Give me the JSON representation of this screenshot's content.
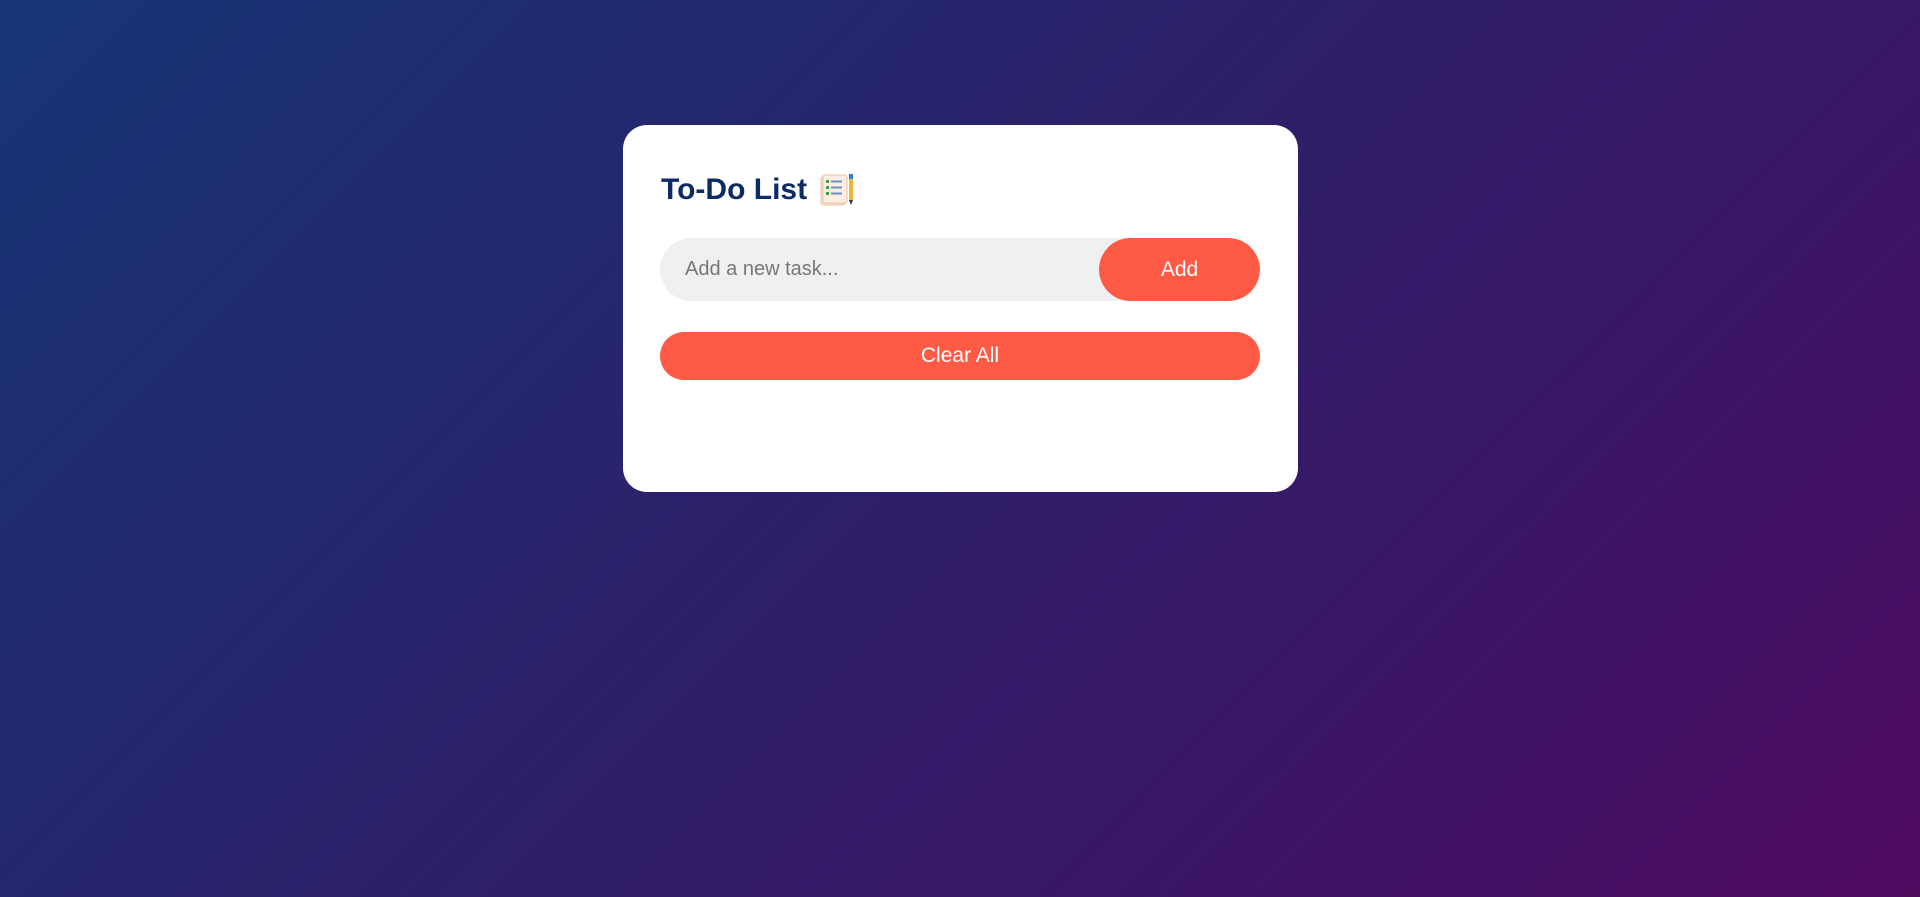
{
  "app": {
    "title": "To-Do List",
    "title_icon": "checklist-notepad-icon"
  },
  "task_input": {
    "value": "",
    "placeholder": "Add a new task..."
  },
  "buttons": {
    "add_label": "Add",
    "clear_all_label": "Clear All"
  },
  "tasks": [],
  "colors": {
    "accent": "#ff5a45",
    "title": "#0c2a66",
    "input_bg": "#eef0f2",
    "card_bg": "#ffffff",
    "gradient_start": "#163577",
    "gradient_end": "#4f0a5e"
  }
}
